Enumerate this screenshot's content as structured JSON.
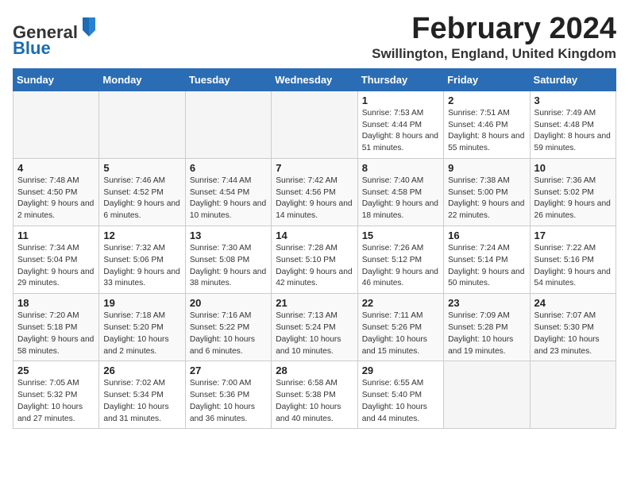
{
  "header": {
    "logo_general": "General",
    "logo_blue": "Blue",
    "title": "February 2024",
    "subtitle": "Swillington, England, United Kingdom"
  },
  "weekdays": [
    "Sunday",
    "Monday",
    "Tuesday",
    "Wednesday",
    "Thursday",
    "Friday",
    "Saturday"
  ],
  "weeks": [
    [
      {
        "day": "",
        "info": ""
      },
      {
        "day": "",
        "info": ""
      },
      {
        "day": "",
        "info": ""
      },
      {
        "day": "",
        "info": ""
      },
      {
        "day": "1",
        "info": "Sunrise: 7:53 AM\nSunset: 4:44 PM\nDaylight: 8 hours\nand 51 minutes."
      },
      {
        "day": "2",
        "info": "Sunrise: 7:51 AM\nSunset: 4:46 PM\nDaylight: 8 hours\nand 55 minutes."
      },
      {
        "day": "3",
        "info": "Sunrise: 7:49 AM\nSunset: 4:48 PM\nDaylight: 8 hours\nand 59 minutes."
      }
    ],
    [
      {
        "day": "4",
        "info": "Sunrise: 7:48 AM\nSunset: 4:50 PM\nDaylight: 9 hours\nand 2 minutes."
      },
      {
        "day": "5",
        "info": "Sunrise: 7:46 AM\nSunset: 4:52 PM\nDaylight: 9 hours\nand 6 minutes."
      },
      {
        "day": "6",
        "info": "Sunrise: 7:44 AM\nSunset: 4:54 PM\nDaylight: 9 hours\nand 10 minutes."
      },
      {
        "day": "7",
        "info": "Sunrise: 7:42 AM\nSunset: 4:56 PM\nDaylight: 9 hours\nand 14 minutes."
      },
      {
        "day": "8",
        "info": "Sunrise: 7:40 AM\nSunset: 4:58 PM\nDaylight: 9 hours\nand 18 minutes."
      },
      {
        "day": "9",
        "info": "Sunrise: 7:38 AM\nSunset: 5:00 PM\nDaylight: 9 hours\nand 22 minutes."
      },
      {
        "day": "10",
        "info": "Sunrise: 7:36 AM\nSunset: 5:02 PM\nDaylight: 9 hours\nand 26 minutes."
      }
    ],
    [
      {
        "day": "11",
        "info": "Sunrise: 7:34 AM\nSunset: 5:04 PM\nDaylight: 9 hours\nand 29 minutes."
      },
      {
        "day": "12",
        "info": "Sunrise: 7:32 AM\nSunset: 5:06 PM\nDaylight: 9 hours\nand 33 minutes."
      },
      {
        "day": "13",
        "info": "Sunrise: 7:30 AM\nSunset: 5:08 PM\nDaylight: 9 hours\nand 38 minutes."
      },
      {
        "day": "14",
        "info": "Sunrise: 7:28 AM\nSunset: 5:10 PM\nDaylight: 9 hours\nand 42 minutes."
      },
      {
        "day": "15",
        "info": "Sunrise: 7:26 AM\nSunset: 5:12 PM\nDaylight: 9 hours\nand 46 minutes."
      },
      {
        "day": "16",
        "info": "Sunrise: 7:24 AM\nSunset: 5:14 PM\nDaylight: 9 hours\nand 50 minutes."
      },
      {
        "day": "17",
        "info": "Sunrise: 7:22 AM\nSunset: 5:16 PM\nDaylight: 9 hours\nand 54 minutes."
      }
    ],
    [
      {
        "day": "18",
        "info": "Sunrise: 7:20 AM\nSunset: 5:18 PM\nDaylight: 9 hours\nand 58 minutes."
      },
      {
        "day": "19",
        "info": "Sunrise: 7:18 AM\nSunset: 5:20 PM\nDaylight: 10 hours\nand 2 minutes."
      },
      {
        "day": "20",
        "info": "Sunrise: 7:16 AM\nSunset: 5:22 PM\nDaylight: 10 hours\nand 6 minutes."
      },
      {
        "day": "21",
        "info": "Sunrise: 7:13 AM\nSunset: 5:24 PM\nDaylight: 10 hours\nand 10 minutes."
      },
      {
        "day": "22",
        "info": "Sunrise: 7:11 AM\nSunset: 5:26 PM\nDaylight: 10 hours\nand 15 minutes."
      },
      {
        "day": "23",
        "info": "Sunrise: 7:09 AM\nSunset: 5:28 PM\nDaylight: 10 hours\nand 19 minutes."
      },
      {
        "day": "24",
        "info": "Sunrise: 7:07 AM\nSunset: 5:30 PM\nDaylight: 10 hours\nand 23 minutes."
      }
    ],
    [
      {
        "day": "25",
        "info": "Sunrise: 7:05 AM\nSunset: 5:32 PM\nDaylight: 10 hours\nand 27 minutes."
      },
      {
        "day": "26",
        "info": "Sunrise: 7:02 AM\nSunset: 5:34 PM\nDaylight: 10 hours\nand 31 minutes."
      },
      {
        "day": "27",
        "info": "Sunrise: 7:00 AM\nSunset: 5:36 PM\nDaylight: 10 hours\nand 36 minutes."
      },
      {
        "day": "28",
        "info": "Sunrise: 6:58 AM\nSunset: 5:38 PM\nDaylight: 10 hours\nand 40 minutes."
      },
      {
        "day": "29",
        "info": "Sunrise: 6:55 AM\nSunset: 5:40 PM\nDaylight: 10 hours\nand 44 minutes."
      },
      {
        "day": "",
        "info": ""
      },
      {
        "day": "",
        "info": ""
      }
    ]
  ]
}
